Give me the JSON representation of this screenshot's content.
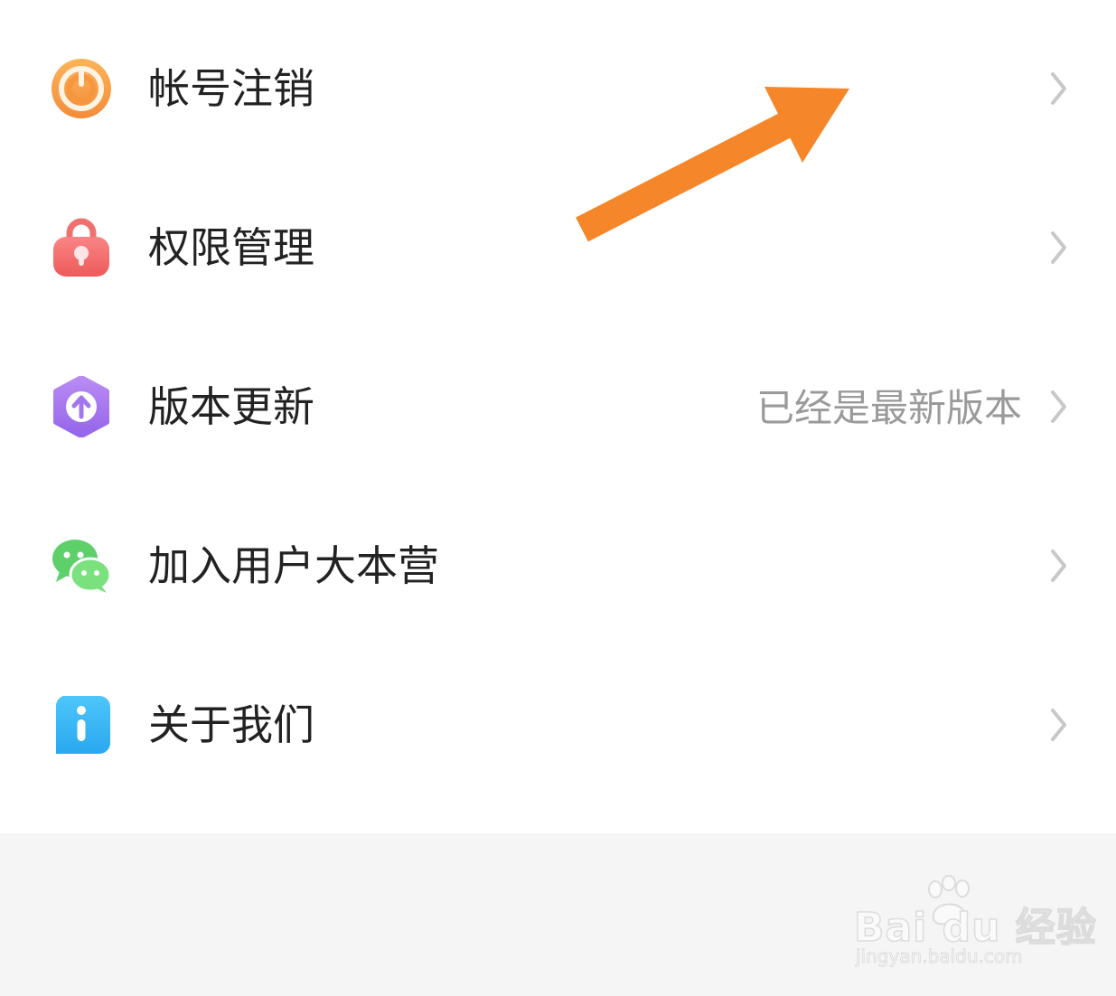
{
  "settings": {
    "items": [
      {
        "label": "帐号注销",
        "value": "",
        "icon": "power-icon",
        "icon_color": "#F7A04A"
      },
      {
        "label": "权限管理",
        "value": "",
        "icon": "lock-icon",
        "icon_color": "#F26B6B"
      },
      {
        "label": "版本更新",
        "value": "已经是最新版本",
        "icon": "upload-arrow-icon",
        "icon_color": "#A97BEF"
      },
      {
        "label": "加入用户大本营",
        "value": "",
        "icon": "wechat-icon",
        "icon_color": "#4CD964"
      },
      {
        "label": "关于我们",
        "value": "",
        "icon": "info-icon",
        "icon_color": "#3AB7F5"
      }
    ]
  },
  "annotation": {
    "arrow_color": "#F5862A"
  },
  "watermark": {
    "brand": "Bai du 经验",
    "url": "jingyan.baidu.com"
  },
  "colors": {
    "background": "#FFFFFF",
    "footer_background": "#F5F5F5",
    "label_text": "#222222",
    "value_text": "#9A9A9A",
    "chevron": "#C8C8C8"
  }
}
